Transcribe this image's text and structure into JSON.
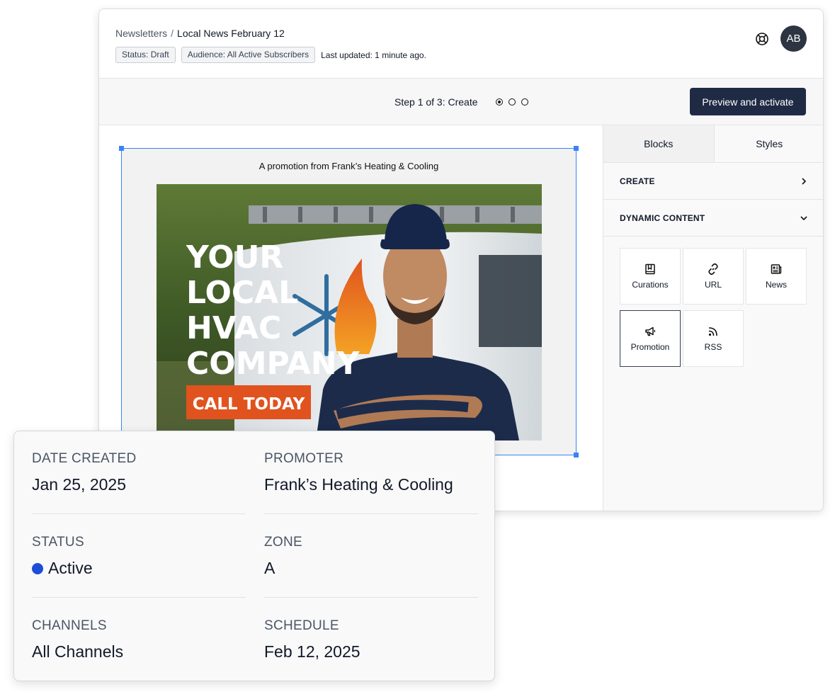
{
  "header": {
    "breadcrumb_parent": "Newsletters",
    "breadcrumb_separator": "/",
    "breadcrumb_current": "Local News February 12",
    "status_badge": "Status: Draft",
    "audience_badge": "Audience: All Active Subscribers",
    "last_updated": "Last updated: 1 minute ago.",
    "avatar_initials": "AB",
    "help_icon": "lifebuoy-icon"
  },
  "stepbar": {
    "step_label": "Step 1 of 3: Create",
    "steps_total": 3,
    "current_step": 1,
    "preview_button": "Preview and activate"
  },
  "email": {
    "promo_line": "A promotion from Frank’s Heating & Cooling",
    "hero": {
      "headline_lines": [
        "YOUR",
        "LOCAL",
        "HVAC",
        "COMPANY"
      ],
      "cta": "CALL TODAY"
    }
  },
  "sidebar": {
    "tabs": [
      {
        "label": "Blocks",
        "active": true
      },
      {
        "label": "Styles",
        "active": false
      }
    ],
    "sections": [
      {
        "title": "CREATE",
        "state": "collapsed"
      },
      {
        "title": "DYNAMIC CONTENT",
        "state": "expanded"
      }
    ],
    "blocks": [
      {
        "label": "Curations",
        "icon": "bookmark-book-icon"
      },
      {
        "label": "URL",
        "icon": "link-icon"
      },
      {
        "label": "News",
        "icon": "newspaper-icon"
      },
      {
        "label": "Promotion",
        "icon": "megaphone-icon",
        "selected": true
      },
      {
        "label": "RSS",
        "icon": "rss-icon"
      }
    ]
  },
  "details_card": {
    "date_created_label": "DATE CREATED",
    "date_created": "Jan 25, 2025",
    "promoter_label": "PROMOTER",
    "promoter": "Frank’s Heating & Cooling",
    "status_label": "STATUS",
    "status": "Active",
    "zone_label": "ZONE",
    "zone": "A",
    "channels_label": "CHANNELS",
    "channels": "All Channels",
    "schedule_label": "SCHEDULE",
    "schedule": "Feb 12, 2025"
  },
  "colors": {
    "primary_button": "#1f2b45",
    "selection_blue": "#3b82f6",
    "status_active": "#1d4ed8",
    "cta_orange": "#e0531f"
  }
}
